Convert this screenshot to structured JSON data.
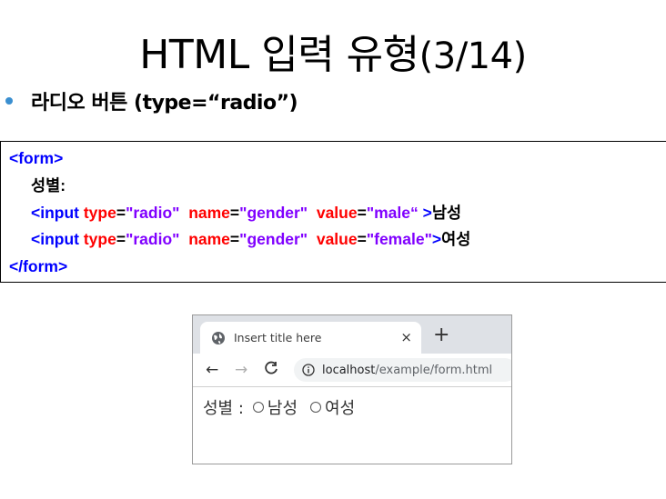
{
  "slide": {
    "title_main": "HTML 입력 유형",
    "title_suffix": "(3/14)",
    "bullet": "라디오 버튼 (type=“radio”)"
  },
  "code": {
    "form_open": "<form>",
    "gender_text": "성별:",
    "input1": {
      "open": "<input",
      "type_attr": "type",
      "type_val": "\"radio\"",
      "name_attr": "name",
      "name_val": "\"gender\"",
      "value_attr": "value",
      "value_val": "\"male“",
      "close": ">",
      "label": "남성"
    },
    "input2": {
      "open": "<input",
      "type_attr": "type",
      "type_val": "\"radio\"",
      "name_attr": "name",
      "name_val": "\"gender\"",
      "value_attr": "value",
      "value_val": "\"female\"",
      "close": ">",
      "label": "여성"
    },
    "eq": "=",
    "form_close": "</form>"
  },
  "browser": {
    "tab_title": "Insert title here",
    "close_glyph": "×",
    "new_tab_glyph": "+",
    "back_glyph": "←",
    "forward_glyph": "→",
    "reload_glyph": "C",
    "url_host": "localhost",
    "url_path": "/example/form.html",
    "page": {
      "label": "성별 :",
      "option1": "남성",
      "option2": "여성"
    }
  },
  "colors": {
    "tag": "#0000ff",
    "attribute": "#ff0000",
    "value": "#8000ff",
    "bullet": "#3a8fd0"
  }
}
